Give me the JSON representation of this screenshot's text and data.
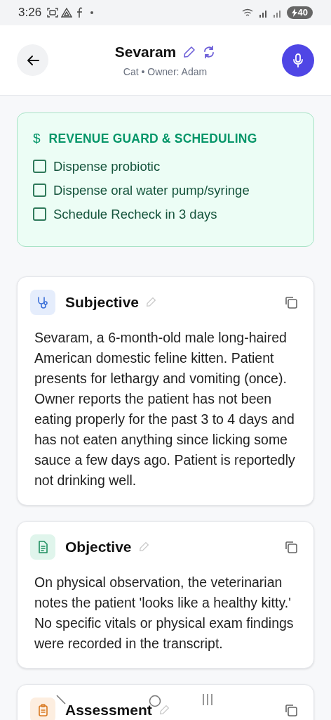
{
  "status_bar": {
    "time": "3:26",
    "battery": "40"
  },
  "header": {
    "title": "Sevaram",
    "subtitle": "Cat • Owner: Adam"
  },
  "revenue": {
    "icon": "$",
    "title": "REVENUE GUARD & SCHEDULING",
    "items": [
      {
        "label": "Dispense probiotic",
        "checked": false
      },
      {
        "label": "Dispense oral water pump/syringe",
        "checked": false
      },
      {
        "label": "Schedule Recheck in 3 days",
        "checked": false
      }
    ]
  },
  "sections": [
    {
      "kind": "subjective",
      "title": "Subjective",
      "body": "Sevaram, a 6-month-old male long-haired American domestic feline kitten. Patient presents for lethargy and vomiting (once). Owner reports the patient has not been eating properly for the past 3 to 4 days and has not eaten anything since licking some sauce a few days ago. Patient is reportedly not drinking well."
    },
    {
      "kind": "objective",
      "title": "Objective",
      "body": "On physical observation, the veterinarian notes the patient 'looks like a healthy kitty.' No specific vitals or physical exam findings were recorded in the transcript."
    },
    {
      "kind": "assessment",
      "title": "Assessment"
    }
  ]
}
